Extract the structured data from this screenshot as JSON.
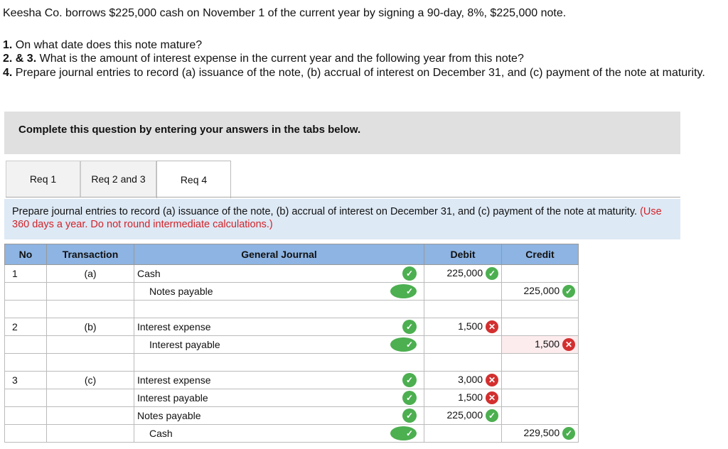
{
  "intro": "Keesha Co. borrows $225,000 cash on November 1 of the current year by signing a 90-day, 8%, $225,000 note.",
  "questions": [
    {
      "num": "1.",
      "text": "On what date does this note mature?"
    },
    {
      "num": "2. & 3.",
      "text": "What is the amount of interest expense in the current year and the following year from this note?"
    },
    {
      "num": "4.",
      "text": "Prepare journal entries to record (a) issuance of the note, (b) accrual of interest on December 31, and (c) payment of the note at maturity."
    }
  ],
  "banner": "Complete this question by entering your answers in the tabs below.",
  "tabs": [
    "Req 1",
    "Req 2 and 3",
    "Req 4"
  ],
  "instructions": {
    "text": "Prepare journal entries to record (a) issuance of the note, (b) accrual of interest on December 31, and (c) payment of the note at maturity.",
    "note": "(Use 360 days a year. Do not round intermediate calculations.)"
  },
  "table": {
    "headers": [
      "No",
      "Transaction",
      "General Journal",
      "Debit",
      "Credit"
    ],
    "rows": [
      {
        "no": "1",
        "tr": "(a)",
        "acct": "Cash",
        "indent": false,
        "acct_ok": true,
        "debit": "225,000",
        "debit_ok": true,
        "credit": "",
        "credit_ok": null
      },
      {
        "no": "",
        "tr": "",
        "acct": "Notes payable",
        "indent": true,
        "acct_ok": true,
        "debit": "",
        "debit_ok": null,
        "credit": "225,000",
        "credit_ok": true
      },
      {
        "no": "",
        "tr": "",
        "acct": "",
        "indent": false,
        "acct_ok": null,
        "debit": "",
        "debit_ok": null,
        "credit": "",
        "credit_ok": null
      },
      {
        "no": "2",
        "tr": "(b)",
        "acct": "Interest expense",
        "indent": false,
        "acct_ok": true,
        "debit": "1,500",
        "debit_ok": false,
        "credit": "",
        "credit_ok": null
      },
      {
        "no": "",
        "tr": "",
        "acct": "Interest payable",
        "indent": true,
        "acct_ok": true,
        "debit": "",
        "debit_ok": null,
        "credit": "1,500",
        "credit_ok": false
      },
      {
        "no": "",
        "tr": "",
        "acct": "",
        "indent": false,
        "acct_ok": null,
        "debit": "",
        "debit_ok": null,
        "credit": "",
        "credit_ok": null
      },
      {
        "no": "3",
        "tr": "(c)",
        "acct": "Interest expense",
        "indent": false,
        "acct_ok": true,
        "debit": "3,000",
        "debit_ok": false,
        "credit": "",
        "credit_ok": null
      },
      {
        "no": "",
        "tr": "",
        "acct": "Interest payable",
        "indent": false,
        "acct_ok": true,
        "debit": "1,500",
        "debit_ok": false,
        "credit": "",
        "credit_ok": null
      },
      {
        "no": "",
        "tr": "",
        "acct": "Notes payable",
        "indent": false,
        "acct_ok": true,
        "debit": "225,000",
        "debit_ok": true,
        "credit": "",
        "credit_ok": null
      },
      {
        "no": "",
        "tr": "",
        "acct": "Cash",
        "indent": true,
        "acct_ok": true,
        "debit": "",
        "debit_ok": null,
        "credit": "229,500",
        "credit_ok": true
      }
    ]
  },
  "colors": {
    "banner": "#e0e0e0",
    "instructions_bg": "#dde9f5",
    "header_bg": "#8db4e2",
    "note_red": "#d2232a",
    "check_green": "#4caf50",
    "x_red": "#d32f2f"
  }
}
